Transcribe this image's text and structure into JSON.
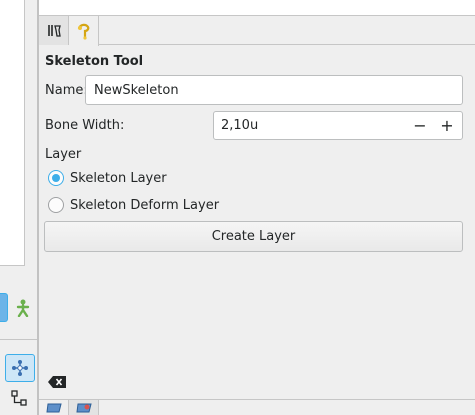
{
  "panel_tabs": [
    {
      "icon": "tool-params-icon"
    },
    {
      "icon": "skeleton-tool-icon"
    }
  ],
  "tool": {
    "title": "Skeleton Tool",
    "name_label": "Name:",
    "name_value": "NewSkeleton",
    "bone_width_label": "Bone Width:",
    "bone_width_value": "2,10u",
    "minus_label": "−",
    "plus_label": "+",
    "layer_label": "Layer",
    "layer_options": [
      {
        "label": "Skeleton Layer",
        "checked": true
      },
      {
        "label": "Skeleton Deform Layer",
        "checked": false
      }
    ],
    "create_button_label": "Create Layer"
  },
  "colors": {
    "accent": "#3daee9",
    "panel_bg": "#efefef"
  }
}
